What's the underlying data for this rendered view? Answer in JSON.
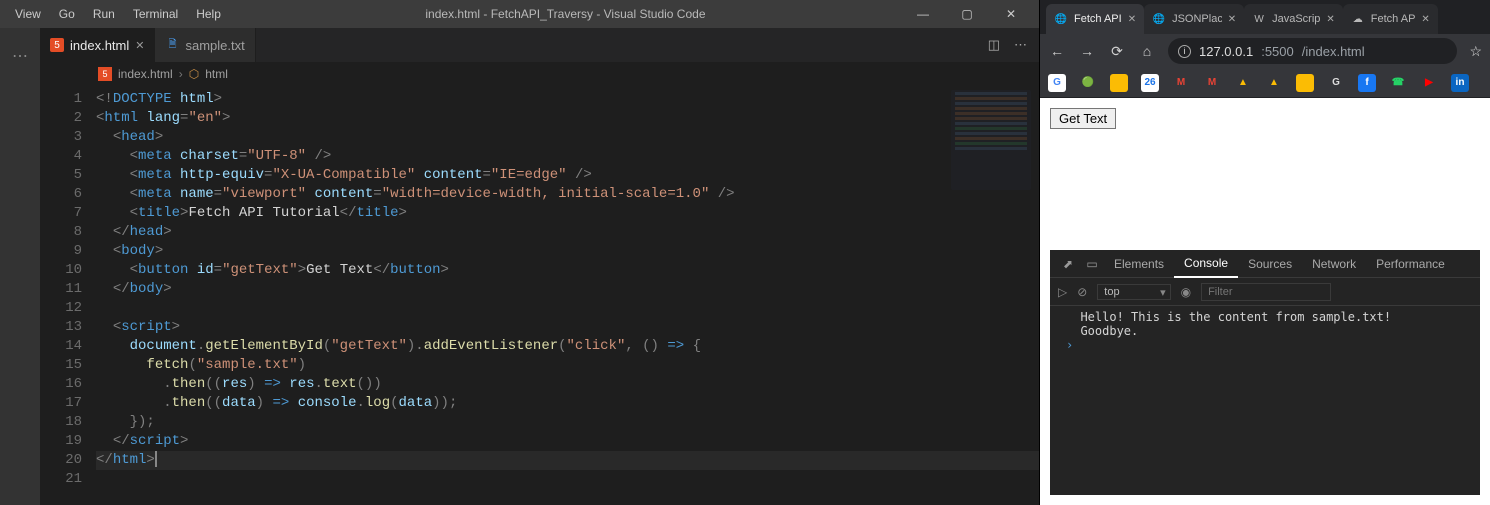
{
  "menubar": {
    "items": [
      "View",
      "Go",
      "Run",
      "Terminal",
      "Help"
    ],
    "title": "index.html - FetchAPI_Traversy - Visual Studio Code"
  },
  "tabs": [
    {
      "label": "index.html",
      "icon": "html5-icon",
      "active": true,
      "dirty": false
    },
    {
      "label": "sample.txt",
      "icon": "text-file-icon",
      "active": false,
      "dirty": false
    }
  ],
  "breadcrumbs": {
    "file": "index.html",
    "symbol": "html"
  },
  "code": {
    "lines": [
      {
        "n": 1,
        "ind": 0,
        "html": "<span class='c-punc'>&lt;!</span><span class='c-doctype'>DOCTYPE</span> <span class='c-attr'>html</span><span class='c-punc'>&gt;</span>"
      },
      {
        "n": 2,
        "ind": 0,
        "html": "<span class='c-punc'>&lt;</span><span class='c-tag'>html</span> <span class='c-attr'>lang</span><span class='c-punc'>=</span><span class='c-str'>\"en\"</span><span class='c-punc'>&gt;</span>"
      },
      {
        "n": 3,
        "ind": 1,
        "html": "<span class='c-punc'>&lt;</span><span class='c-tag'>head</span><span class='c-punc'>&gt;</span>"
      },
      {
        "n": 4,
        "ind": 2,
        "html": "<span class='c-punc'>&lt;</span><span class='c-tag'>meta</span> <span class='c-attr'>charset</span><span class='c-punc'>=</span><span class='c-str'>\"UTF-8\"</span> <span class='c-punc'>/&gt;</span>"
      },
      {
        "n": 5,
        "ind": 2,
        "html": "<span class='c-punc'>&lt;</span><span class='c-tag'>meta</span> <span class='c-attr'>http-equiv</span><span class='c-punc'>=</span><span class='c-str'>\"X-UA-Compatible\"</span> <span class='c-attr'>content</span><span class='c-punc'>=</span><span class='c-str'>\"IE=edge\"</span> <span class='c-punc'>/&gt;</span>"
      },
      {
        "n": 6,
        "ind": 2,
        "html": "<span class='c-punc'>&lt;</span><span class='c-tag'>meta</span> <span class='c-attr'>name</span><span class='c-punc'>=</span><span class='c-str'>\"viewport\"</span> <span class='c-attr'>content</span><span class='c-punc'>=</span><span class='c-str'>\"width=device-width, initial-scale=1.0\"</span> <span class='c-punc'>/&gt;</span>"
      },
      {
        "n": 7,
        "ind": 2,
        "html": "<span class='c-punc'>&lt;</span><span class='c-tag'>title</span><span class='c-punc'>&gt;</span><span class='c-plain'>Fetch API Tutorial</span><span class='c-punc'>&lt;/</span><span class='c-tag'>title</span><span class='c-punc'>&gt;</span>"
      },
      {
        "n": 8,
        "ind": 1,
        "html": "<span class='c-punc'>&lt;/</span><span class='c-tag'>head</span><span class='c-punc'>&gt;</span>"
      },
      {
        "n": 9,
        "ind": 1,
        "html": "<span class='c-punc'>&lt;</span><span class='c-tag'>body</span><span class='c-punc'>&gt;</span>"
      },
      {
        "n": 10,
        "ind": 2,
        "html": "<span class='c-punc'>&lt;</span><span class='c-tag'>button</span> <span class='c-attr'>id</span><span class='c-punc'>=</span><span class='c-str'>\"getText\"</span><span class='c-punc'>&gt;</span><span class='c-plain'>Get Text</span><span class='c-punc'>&lt;/</span><span class='c-tag'>button</span><span class='c-punc'>&gt;</span>"
      },
      {
        "n": 11,
        "ind": 1,
        "html": "<span class='c-punc'>&lt;/</span><span class='c-tag'>body</span><span class='c-punc'>&gt;</span>"
      },
      {
        "n": 12,
        "ind": 0,
        "html": ""
      },
      {
        "n": 13,
        "ind": 1,
        "html": "<span class='c-punc'>&lt;</span><span class='c-tag'>script</span><span class='c-punc'>&gt;</span>"
      },
      {
        "n": 14,
        "ind": 2,
        "html": "<span class='c-var'>document</span><span class='c-punc'>.</span><span class='c-func'>getElementById</span><span class='c-punc'>(</span><span class='c-str'>\"getText\"</span><span class='c-punc'>).</span><span class='c-func'>addEventListener</span><span class='c-punc'>(</span><span class='c-str'>\"click\"</span><span class='c-punc'>, () </span><span class='c-kw'>=&gt;</span><span class='c-punc'> {</span>"
      },
      {
        "n": 15,
        "ind": 3,
        "html": "<span class='c-func'>fetch</span><span class='c-punc'>(</span><span class='c-str'>\"sample.txt\"</span><span class='c-punc'>)</span>"
      },
      {
        "n": 16,
        "ind": 4,
        "html": "<span class='c-punc'>.</span><span class='c-func'>then</span><span class='c-punc'>((</span><span class='c-var'>res</span><span class='c-punc'>) </span><span class='c-kw'>=&gt;</span><span class='c-punc'> </span><span class='c-var'>res</span><span class='c-punc'>.</span><span class='c-func'>text</span><span class='c-punc'>())</span>"
      },
      {
        "n": 17,
        "ind": 4,
        "html": "<span class='c-punc'>.</span><span class='c-func'>then</span><span class='c-punc'>((</span><span class='c-var'>data</span><span class='c-punc'>) </span><span class='c-kw'>=&gt;</span><span class='c-punc'> </span><span class='c-var'>console</span><span class='c-punc'>.</span><span class='c-func'>log</span><span class='c-punc'>(</span><span class='c-var'>data</span><span class='c-punc'>));</span>"
      },
      {
        "n": 18,
        "ind": 2,
        "html": "<span class='c-punc'>});</span>"
      },
      {
        "n": 19,
        "ind": 1,
        "html": "<span class='c-punc'>&lt;/</span><span class='c-tag'>script</span><span class='c-punc'>&gt;</span>"
      },
      {
        "n": 20,
        "ind": 0,
        "html": "<span class='c-punc'>&lt;/</span><span class='c-tag'>html</span><span class='c-punc'>&gt;</span><span class='cursor-box'></span>",
        "current": true
      },
      {
        "n": 21,
        "ind": 0,
        "html": ""
      }
    ]
  },
  "browser": {
    "tabs": [
      {
        "title": "Fetch API",
        "favicon": "globe-icon",
        "active": true
      },
      {
        "title": "JSONPlac",
        "favicon": "globe-icon",
        "active": false
      },
      {
        "title": "JavaScrip",
        "favicon": "w3-icon",
        "active": false
      },
      {
        "title": "Fetch AP",
        "favicon": "cloud-icon",
        "active": false
      }
    ],
    "url_host": "127.0.0.1",
    "url_port": ":5500",
    "url_path": "/index.html",
    "bookmarks": [
      {
        "name": "google-icon",
        "bg": "#ffffff",
        "txt": "G",
        "fg": "#4285f4"
      },
      {
        "name": "evernote-icon",
        "bg": "transparent",
        "txt": "🟢",
        "fg": "#2dbe60"
      },
      {
        "name": "keep-icon",
        "bg": "#fbbc04",
        "txt": "",
        "fg": "#fff"
      },
      {
        "name": "calendar-icon",
        "bg": "#ffffff",
        "txt": "26",
        "fg": "#1a73e8"
      },
      {
        "name": "gmail-icon",
        "bg": "transparent",
        "txt": "M",
        "fg": "#ea4335"
      },
      {
        "name": "gmail2-icon",
        "bg": "transparent",
        "txt": "M",
        "fg": "#ea4335"
      },
      {
        "name": "drive-icon",
        "bg": "transparent",
        "txt": "▲",
        "fg": "#fbbc04"
      },
      {
        "name": "drive2-icon",
        "bg": "transparent",
        "txt": "▲",
        "fg": "#fbbc04"
      },
      {
        "name": "folder-icon",
        "bg": "#fbbc04",
        "txt": "",
        "fg": "#fff"
      },
      {
        "name": "g-letter-icon",
        "bg": "transparent",
        "txt": "G",
        "fg": "#ddd"
      },
      {
        "name": "facebook-icon",
        "bg": "#1877f2",
        "txt": "f",
        "fg": "#fff"
      },
      {
        "name": "whatsapp-icon",
        "bg": "transparent",
        "txt": "☎",
        "fg": "#25d366"
      },
      {
        "name": "youtube-icon",
        "bg": "transparent",
        "txt": "▶",
        "fg": "#ff0000"
      },
      {
        "name": "linkedin-icon",
        "bg": "#0a66c2",
        "txt": "in",
        "fg": "#fff"
      }
    ],
    "page": {
      "button_label": "Get Text"
    },
    "devtools": {
      "tabs": [
        "Elements",
        "Console",
        "Sources",
        "Network",
        "Performance"
      ],
      "active_tab": "Console",
      "context": "top",
      "filter_placeholder": "Filter",
      "console_lines": [
        "  Hello! This is the content from sample.txt!",
        "  Goodbye."
      ]
    }
  }
}
